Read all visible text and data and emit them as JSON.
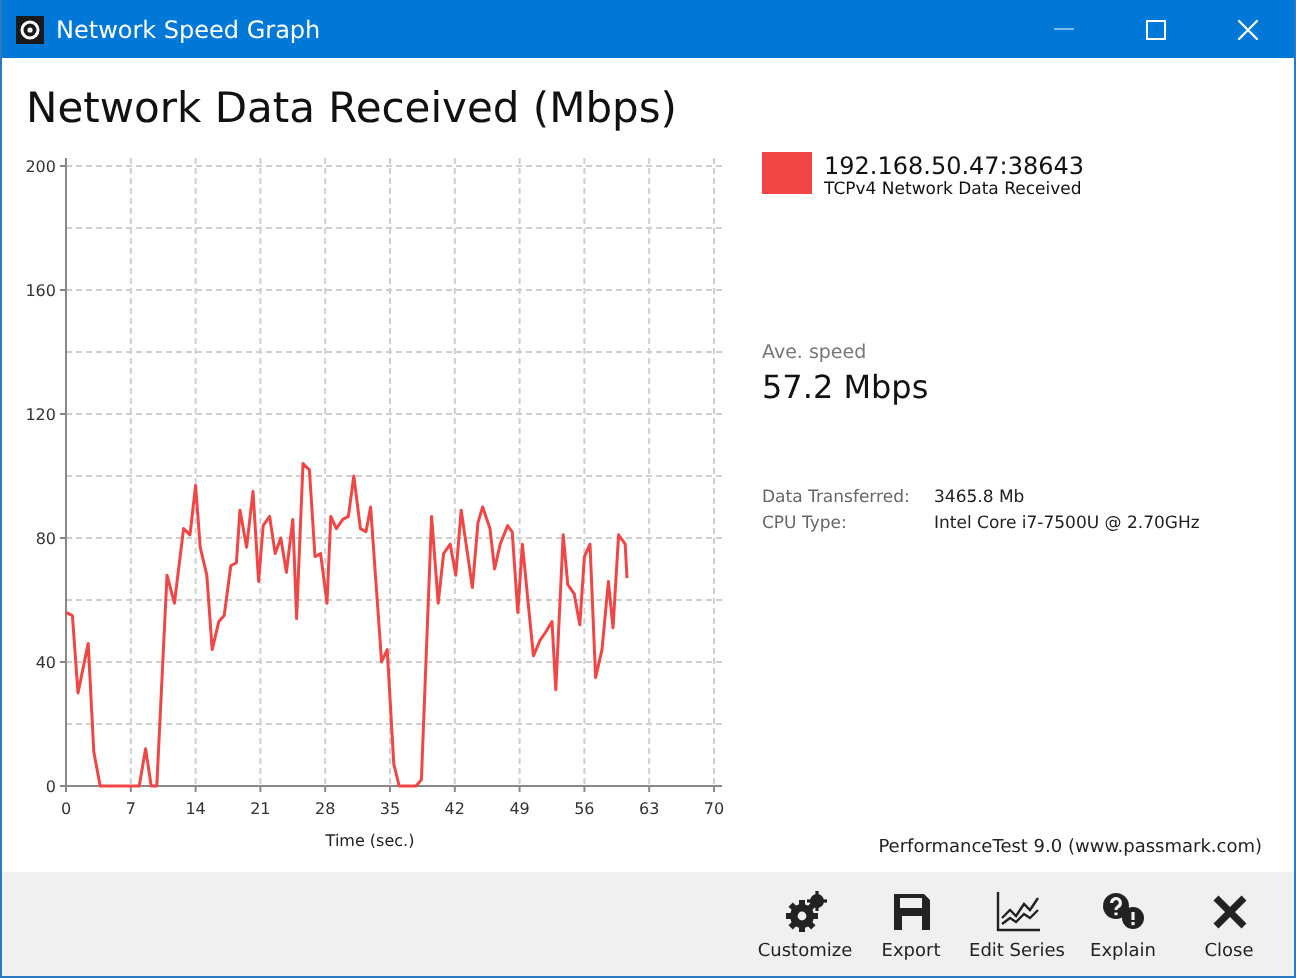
{
  "window": {
    "title": "Network Speed Graph"
  },
  "heading": "Network Data Received (Mbps)",
  "chart": {
    "chart_data": {
      "type": "line",
      "grid": true,
      "xlabel": "Time (sec.)",
      "xlim": [
        0,
        70
      ],
      "ylim": [
        0,
        200
      ],
      "xticks": [
        0,
        7,
        14,
        21,
        28,
        35,
        42,
        49,
        56,
        63,
        70
      ],
      "yticks": [
        0,
        40,
        80,
        120,
        160,
        200
      ],
      "x": [
        0,
        0.7,
        1.3,
        2.4,
        3,
        3.7,
        7.9,
        8.6,
        9.2,
        9.8,
        10.9,
        11.7,
        12.7,
        13.4,
        14,
        14.5,
        15.2,
        15.8,
        16.5,
        17.1,
        17.8,
        18.4,
        18.8,
        19.5,
        20.2,
        20.8,
        21.3,
        22,
        22.6,
        23.2,
        23.8,
        24.5,
        24.9,
        25.6,
        26.3,
        26.9,
        27.5,
        28.2,
        28.6,
        29.2,
        29.9,
        30.5,
        31.1,
        31.8,
        32.4,
        32.9,
        34.1,
        34.7,
        35.4,
        36,
        37.8,
        38.4,
        39.5,
        40.2,
        40.8,
        41.5,
        42.1,
        42.7,
        43.9,
        44.5,
        45,
        45.8,
        46.3,
        46.9,
        47.7,
        48.2,
        48.8,
        49.3,
        50.5,
        51.2,
        51.9,
        52.5,
        52.9,
        53.7,
        54.2,
        54.9,
        55.5,
        56,
        56.6,
        57.2,
        57.9,
        58.6,
        59.1,
        59.7,
        60.4,
        60.6
      ],
      "series": [
        {
          "name": "192.168.50.47:38643",
          "color": "#f04646",
          "values": [
            56,
            55,
            30,
            46,
            11,
            0,
            0,
            12,
            0,
            0,
            68,
            59,
            83,
            81,
            97,
            77,
            68,
            44,
            53,
            55,
            71,
            72,
            89,
            77,
            95,
            66,
            84,
            87,
            75,
            80,
            69,
            86,
            54,
            104,
            102,
            74,
            75,
            59,
            87,
            83,
            86,
            87,
            100,
            83,
            82,
            90,
            40,
            44,
            7,
            0,
            0,
            2,
            87,
            59,
            75,
            78,
            68,
            89,
            64,
            85,
            90,
            83,
            70,
            78,
            84,
            82,
            56,
            78,
            42,
            47,
            50,
            53,
            31,
            81,
            65,
            62,
            52,
            74,
            78,
            35,
            44,
            66,
            51,
            81,
            78,
            67
          ]
        }
      ]
    }
  },
  "legend": {
    "description": "TCPv4 Network Data Received"
  },
  "average": {
    "label": "Ave. speed",
    "value": "57.2 Mbps"
  },
  "details": [
    {
      "label": "Data Transferred:",
      "value": "3465.8 Mb"
    },
    {
      "label": "CPU Type:",
      "value": "Intel Core i7-7500U @ 2.70GHz"
    }
  ],
  "credit": "PerformanceTest 9.0 (www.passmark.com)",
  "toolbar": [
    {
      "kind": "customize",
      "label": "Customize"
    },
    {
      "kind": "export",
      "label": "Export"
    },
    {
      "kind": "series",
      "label": "Edit Series"
    },
    {
      "kind": "explain",
      "label": "Explain"
    },
    {
      "kind": "close",
      "label": "Close"
    }
  ]
}
